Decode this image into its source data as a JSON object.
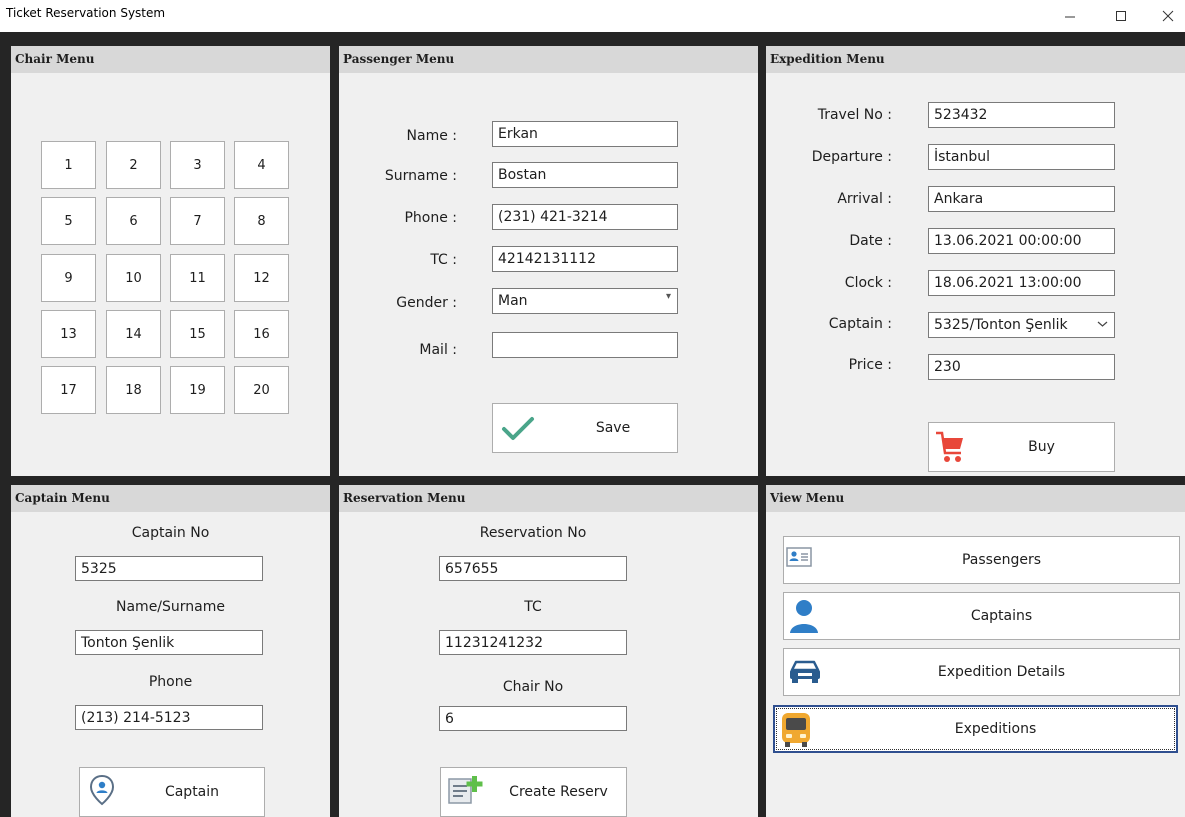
{
  "window": {
    "title": "Ticket Reservation System"
  },
  "chair_menu": {
    "title": "Chair Menu",
    "seats": [
      "1",
      "2",
      "3",
      "4",
      "5",
      "6",
      "7",
      "8",
      "9",
      "10",
      "11",
      "12",
      "13",
      "14",
      "15",
      "16",
      "17",
      "18",
      "19",
      "20"
    ]
  },
  "passenger_menu": {
    "title": "Passenger Menu",
    "name_label": "Name :",
    "name_value": "Erkan",
    "surname_label": "Surname :",
    "surname_value": "Bostan",
    "phone_label": "Phone :",
    "phone_value": "(231) 421-3214",
    "tc_label": "TC :",
    "tc_value": "42142131112",
    "gender_label": "Gender :",
    "gender_value": "Man",
    "mail_label": "Mail :",
    "mail_value": "",
    "save_label": "Save"
  },
  "expedition_menu": {
    "title": "Expedition Menu",
    "travel_no_label": "Travel No :",
    "travel_no_value": "523432",
    "departure_label": "Departure :",
    "departure_value": "İstanbul",
    "arrival_label": "Arrival :",
    "arrival_value": "Ankara",
    "date_label": "Date :",
    "date_value": "13.06.2021 00:00:00",
    "clock_label": "Clock :",
    "clock_value": "18.06.2021 13:00:00",
    "captain_label": "Captain :",
    "captain_value": "5325/Tonton Şenlik",
    "price_label": "Price :",
    "price_value": "230",
    "buy_label": "Buy"
  },
  "captain_menu": {
    "title": "Captain Menu",
    "captain_no_label": "Captain No",
    "captain_no_value": "5325",
    "name_surname_label": "Name/Surname",
    "name_surname_value": "Tonton Şenlik",
    "phone_label": "Phone",
    "phone_value": "(213) 214-5123",
    "captain_button_label": "Captain"
  },
  "reservation_menu": {
    "title": "Reservation Menu",
    "reservation_no_label": "Reservation No",
    "reservation_no_value": "657655",
    "tc_label": "TC",
    "tc_value": "11231241232",
    "chair_no_label": "Chair No",
    "chair_no_value": "6",
    "create_label": "Create Reserv"
  },
  "view_menu": {
    "title": "View Menu",
    "passengers_label": "Passengers",
    "captains_label": "Captains",
    "expedition_details_label": "Expedition Details",
    "expeditions_label": "Expeditions"
  },
  "colors": {
    "panel_bg": "#f0f0f0",
    "panel_header": "#d8d8d8",
    "frame": "#252525",
    "save_check": "#4aa58a",
    "cart": "#e8473a",
    "user_icon": "#2f7ec7",
    "bus": "#f0a830"
  }
}
